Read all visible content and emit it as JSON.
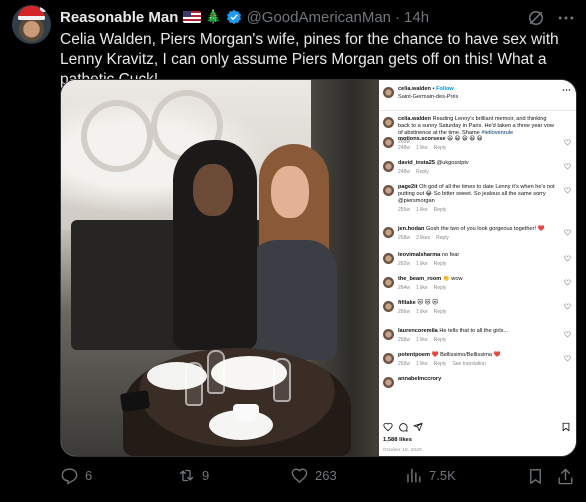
{
  "author": {
    "display_name": "Reasonable Man",
    "badges": [
      "us-flag-icon",
      "christmas-tree-icon",
      "verified-badge-icon"
    ],
    "handle": "@GoodAmericanMan",
    "separator": "·",
    "time": "14h"
  },
  "tweet": {
    "text": "Celia Walden, Piers Morgan's wife, pines for the chance to have sex with Lenny Kravitz, I can only assume Piers Morgan gets off on this! What a pathetic Cuck!"
  },
  "instagram": {
    "username": "celia.walden",
    "follow_separator": "•",
    "follow": "Follow",
    "location": "Saint-Germain-des-Prés",
    "caption_user": "celia.walden",
    "caption": "Reading Lenny's brilliant memoir, and thinking back to a sunny Saturday in Paris. He'd taken a three year vow of abstinence at the time. Shame",
    "caption_hashtag": "#letlovenrule",
    "caption_time": "269w",
    "comments": [
      {
        "user": "motions.scorsese",
        "text": "😆 😆 😆 😆 😆",
        "time": "248w",
        "likes": "1 like",
        "reply": "Reply"
      },
      {
        "user": "david_insta25",
        "text": "@ukgossiptv",
        "time": "248w",
        "likes": "",
        "reply": "Reply"
      },
      {
        "user": "page2it",
        "text": "Oh god of all the times to date Lenny it's when he's not putting out 😂 So bitter sweet. So jealous all the same sorry @piersmorgan",
        "time": "255w",
        "likes": "1 like",
        "reply": "Reply"
      },
      {
        "user": "jen.hodan",
        "text": "Gosh the two of you look gorgeous together! ❤️",
        "time": "268w",
        "likes": "3 likes",
        "reply": "Reply"
      },
      {
        "user": "leovimalsharma",
        "text": "no fear",
        "time": "262w",
        "likes": "1 like",
        "reply": "Reply"
      },
      {
        "user": "the_beam_room",
        "text": "👏 wow",
        "time": "264w",
        "likes": "1 like",
        "reply": "Reply"
      },
      {
        "user": "fifilake",
        "text": "😻 😻 😻",
        "time": "266w",
        "likes": "1 like",
        "reply": "Reply"
      },
      {
        "user": "laurencoremila",
        "text": "He tells that to all the girls...",
        "time": "268w",
        "likes": "1 like",
        "reply": "Reply"
      },
      {
        "user": "potentpoem",
        "text": "❤️ Bellissimo/Bellissima ❤️",
        "time": "269w",
        "likes": "1 like",
        "reply": "Reply",
        "extra": "See translation"
      },
      {
        "user": "annabelmccrory",
        "text": "",
        "time": "",
        "likes": "",
        "reply": ""
      }
    ],
    "likes_count": "1,588 likes",
    "date": "October 10, 2020"
  },
  "actions": {
    "replies": "6",
    "reposts": "9",
    "likes": "263",
    "views": "7.5K"
  },
  "colors": {
    "background": "#000000",
    "text": "#e7e9ea",
    "muted": "#71767b",
    "verified": "#1d9bf0",
    "ig_link": "#0095f6"
  }
}
